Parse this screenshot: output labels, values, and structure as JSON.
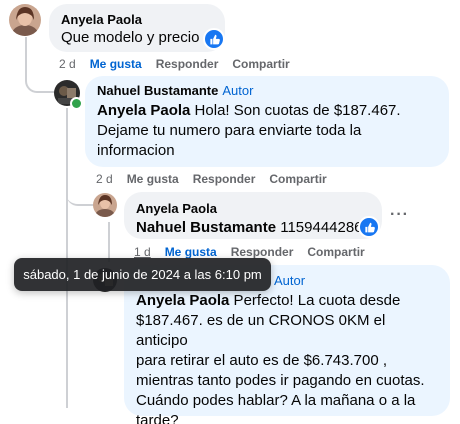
{
  "colors": {
    "link_blue": "#0064d1",
    "like_blue": "#1877f2",
    "bubble_gray": "#f0f2f5",
    "bubble_blue": "#ebf5ff"
  },
  "comments": [
    {
      "author": "Anyela Paola",
      "text": "Que modelo y precio",
      "reaction": "like-icon",
      "time": "2 d",
      "like_label": "Me gusta",
      "reply_label": "Responder",
      "share_label": "Compartir"
    },
    {
      "author": "Nahuel Bustamante",
      "author_tag": "Autor",
      "mention": "Anyela Paola",
      "text_line1": " Hola! Son cuotas de $187.467.",
      "text_line2": "Dejame tu numero para enviarte toda la",
      "text_line3": "informacion",
      "time": "2 d",
      "like_label": "Me gusta",
      "reply_label": "Responder",
      "share_label": "Compartir"
    },
    {
      "author": "Anyela Paola",
      "mention": "Nahuel Bustamante",
      "text": " 1159444286",
      "reaction": "like-icon",
      "time": "1 d",
      "like_label": "Me gusta",
      "reply_label": "Responder",
      "share_label": "Compartir"
    },
    {
      "author_tag": "Autor",
      "mention": "Anyela Paola",
      "text_line1": " Perfecto! La cuota desde",
      "text_line2": "$187.467. es de un CRONOS 0KM el anticipo",
      "text_line3": "para retirar el auto es de $6.743.700 ,",
      "text_line4": "mientras tanto podes ir pagando en cuotas.",
      "text_line5": "Cuándo podes hablar? A la mañana o a la",
      "text_line6": "tarde?"
    }
  ],
  "tooltip": "sábado, 1 de junio de 2024 a las 6:10 pm"
}
